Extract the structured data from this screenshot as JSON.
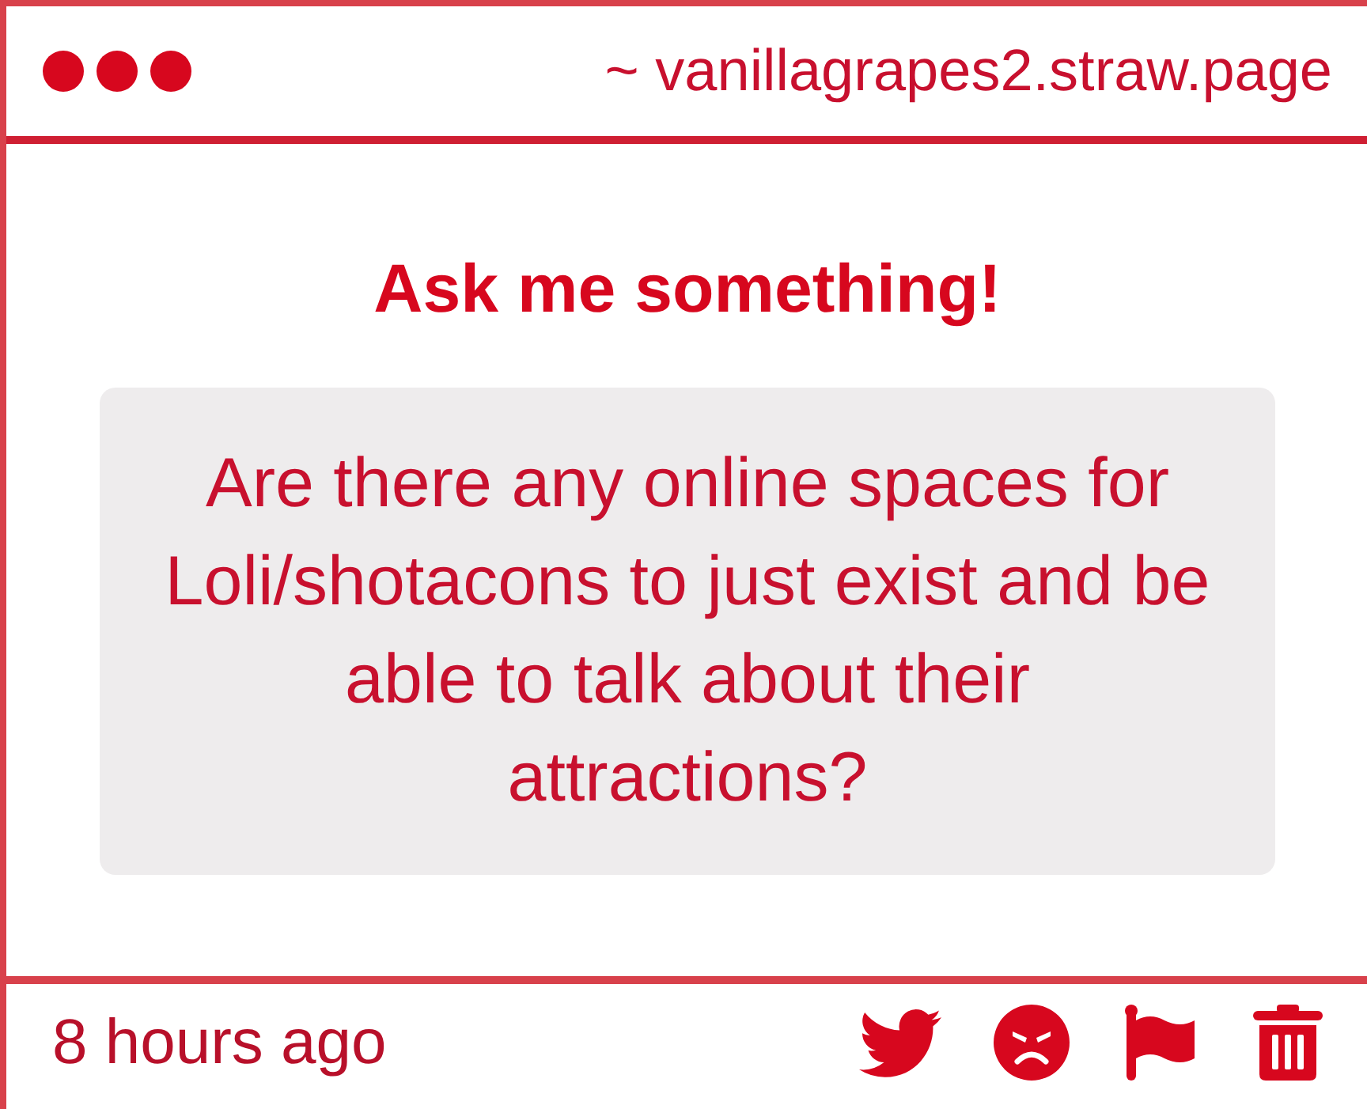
{
  "window": {
    "url": "~ vanillagrapes2.straw.page"
  },
  "heading": "Ask me something!",
  "question": "Are there any online spaces for Loli/shotacons to just exist and be able to talk about their attractions?",
  "footer": {
    "time": "8 hours ago"
  }
}
